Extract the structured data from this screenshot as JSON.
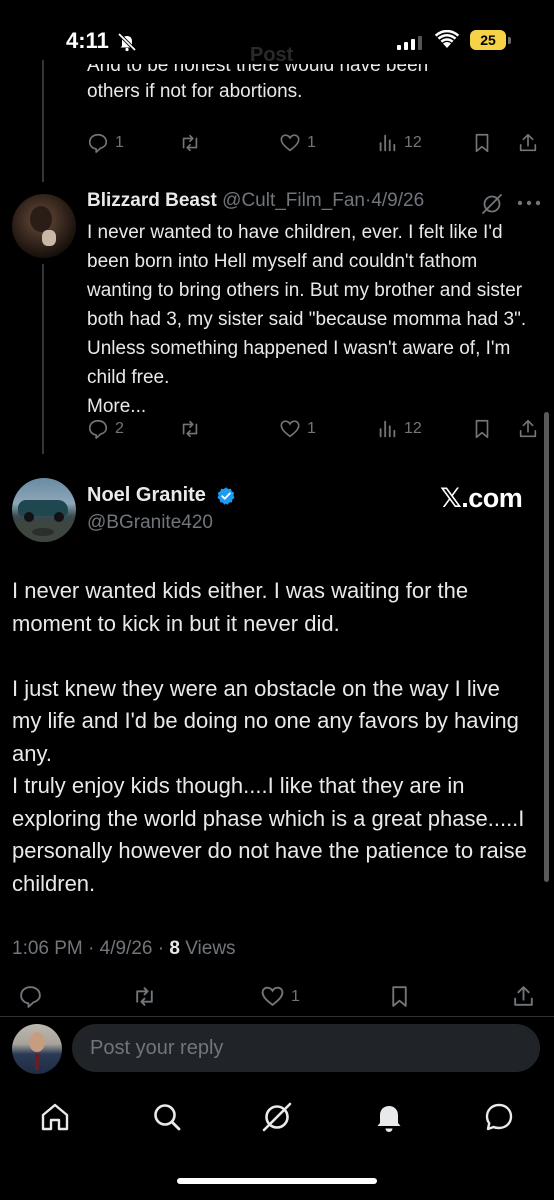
{
  "status_bar": {
    "time": "4:11",
    "battery": "25",
    "ghost_title": "Post"
  },
  "prev_tweet": {
    "clipped_line": "And to be honest there would have been",
    "last_line": "others if not for abortions.",
    "actions": {
      "replies": "1",
      "reposts": "",
      "likes": "1",
      "views": "12"
    }
  },
  "reply_tweet": {
    "name": "Blizzard Beast",
    "handle": "@Cult_Film_Fan",
    "date": "4/9/26",
    "text": "I never wanted to have children, ever. I felt like I'd been born into Hell myself and couldn't fathom wanting to bring others in. But my brother and sister both had 3, my sister said \"because momma had 3\". Unless something happened I wasn't aware of, I'm child free.",
    "more": "More...",
    "actions": {
      "replies": "2",
      "reposts": "",
      "likes": "1",
      "views": "12"
    }
  },
  "main_tweet": {
    "name": "Noel Granite",
    "handle": "@BGranite420",
    "watermark": "𝕏.com",
    "paragraph1": "I never wanted kids either. I was waiting for the moment to kick in but it never did.",
    "paragraph2": "I just knew they were an obstacle on the way I live my life and I'd be doing no one any favors by having any.",
    "paragraph3": "I truly enjoy kids though....I like that they are in exploring the world phase which is a great phase.....I personally however do not have the patience to raise children.",
    "timestamp": "1:06 PM · 4/9/26 · ",
    "views_count": "8",
    "views_label": " Views",
    "actions": {
      "replies": "",
      "reposts": "",
      "likes": "1"
    }
  },
  "reply_bar": {
    "placeholder": "Post your reply"
  },
  "tabs": [
    "home",
    "search",
    "grok",
    "notifications",
    "messages"
  ],
  "colors": {
    "background": "#000000",
    "text": "#e7e9ea",
    "muted": "#71767b",
    "verified": "#1d9bf0",
    "battery": "#f5d247"
  }
}
